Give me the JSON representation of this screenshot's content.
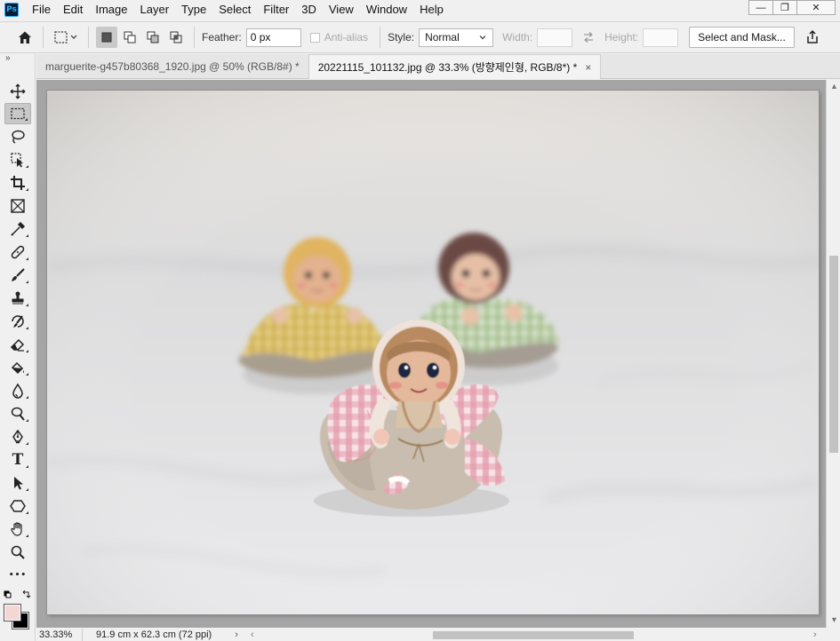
{
  "app": {
    "logo": "Ps"
  },
  "menu": [
    "File",
    "Edit",
    "Image",
    "Layer",
    "Type",
    "Select",
    "Filter",
    "3D",
    "View",
    "Window",
    "Help"
  ],
  "window_controls": {
    "minimize": "—",
    "restore": "❐",
    "close": "✕"
  },
  "options": {
    "feather_label": "Feather:",
    "feather_value": "0 px",
    "anti_alias_label": "Anti-alias",
    "style_label": "Style:",
    "style_value": "Normal",
    "width_label": "Width:",
    "height_label": "Height:",
    "select_mask_label": "Select and Mask..."
  },
  "tabs": [
    {
      "label": "marguerite-g457b80368_1920.jpg @ 50% (RGB/8#) *",
      "active": false
    },
    {
      "label": "20221115_101132.jpg @ 33.3% (방향제인형, RGB/8*) *",
      "active": true
    }
  ],
  "tab_close": "×",
  "tools": [
    {
      "name": "move-tool",
      "icon": "move-icon"
    },
    {
      "name": "rectangular-marquee-tool",
      "icon": "marquee-icon",
      "selected": true
    },
    {
      "name": "lasso-tool",
      "icon": "lasso-icon"
    },
    {
      "name": "object-selection-tool",
      "icon": "object-select-icon"
    },
    {
      "name": "crop-tool",
      "icon": "crop-icon"
    },
    {
      "name": "frame-tool",
      "icon": "frame-icon"
    },
    {
      "name": "eyedropper-tool",
      "icon": "eyedropper-icon"
    },
    {
      "name": "healing-brush-tool",
      "icon": "bandage-icon"
    },
    {
      "name": "brush-tool",
      "icon": "brush-icon"
    },
    {
      "name": "clone-stamp-tool",
      "icon": "stamp-icon"
    },
    {
      "name": "history-brush-tool",
      "icon": "history-brush-icon"
    },
    {
      "name": "eraser-tool",
      "icon": "eraser-icon"
    },
    {
      "name": "paint-bucket-tool",
      "icon": "bucket-icon"
    },
    {
      "name": "blur-tool",
      "icon": "blur-icon"
    },
    {
      "name": "dodge-tool",
      "icon": "dodge-icon"
    },
    {
      "name": "pen-tool",
      "icon": "pen-icon"
    },
    {
      "name": "type-tool",
      "icon": "type-icon"
    },
    {
      "name": "path-selection-tool",
      "icon": "arrow-icon"
    },
    {
      "name": "shape-tool",
      "icon": "hexagon-icon"
    },
    {
      "name": "hand-tool",
      "icon": "hand-icon"
    },
    {
      "name": "zoom-tool",
      "icon": "zoom-icon"
    },
    {
      "name": "more-tools",
      "icon": "ellipsis-icon"
    }
  ],
  "type_glyph": "T",
  "more_glyph": "•••",
  "collapse_glyph": "»",
  "colors": {
    "foreground": "#f2d7d5",
    "background": "#000000",
    "accent": "#31a8ff"
  },
  "status": {
    "zoom": "33.33%",
    "doc_info": "91.9 cm x 62.3 cm (72 ppi)",
    "arrow": "›"
  },
  "scroll_arrows": {
    "up": "▲",
    "down": "▼",
    "left": "‹",
    "right": "›"
  }
}
